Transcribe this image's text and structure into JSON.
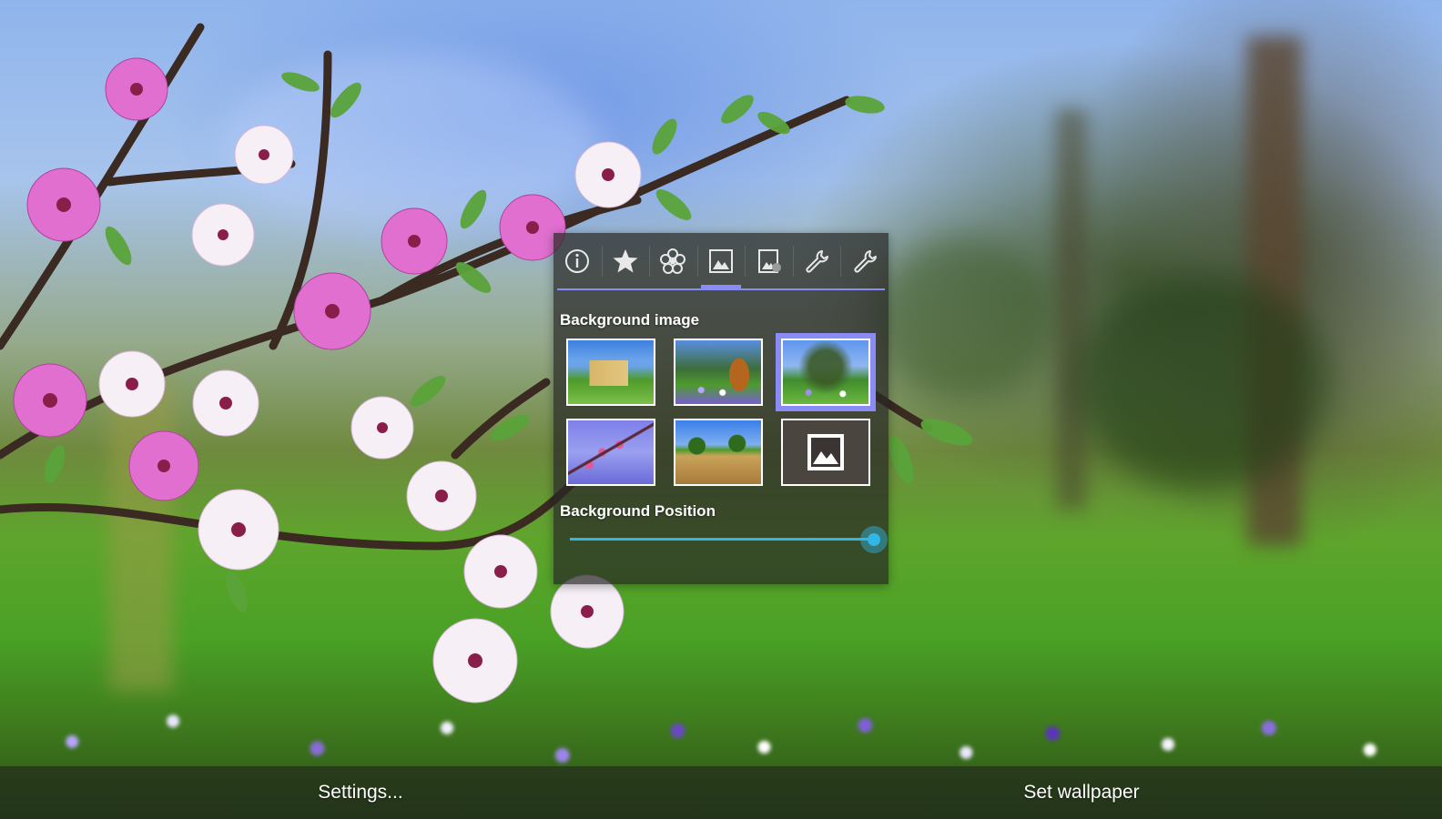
{
  "panel": {
    "tabs": [
      {
        "icon": "info-icon",
        "active": false
      },
      {
        "icon": "star-icon",
        "active": false
      },
      {
        "icon": "flower-icon",
        "active": false
      },
      {
        "icon": "image-icon",
        "active": true
      },
      {
        "icon": "image-settings-icon",
        "active": false
      },
      {
        "icon": "wrench-icon",
        "active": false
      },
      {
        "icon": "wrench-icon",
        "active": false
      }
    ],
    "background_image_title": "Background image",
    "background_images": [
      {
        "name": "castle",
        "selected": false
      },
      {
        "name": "tree-in-field",
        "selected": false
      },
      {
        "name": "park-spring",
        "selected": true
      },
      {
        "name": "blossom-branch",
        "selected": false
      },
      {
        "name": "wheat-field",
        "selected": false
      },
      {
        "name": "custom-image",
        "selected": false
      }
    ],
    "background_position_title": "Background Position",
    "background_position_value": 1.0,
    "accent_color": "#8a8cf5",
    "slider_color": "#33b5e5"
  },
  "bottom_bar": {
    "settings_label": "Settings...",
    "set_wallpaper_label": "Set wallpaper"
  }
}
